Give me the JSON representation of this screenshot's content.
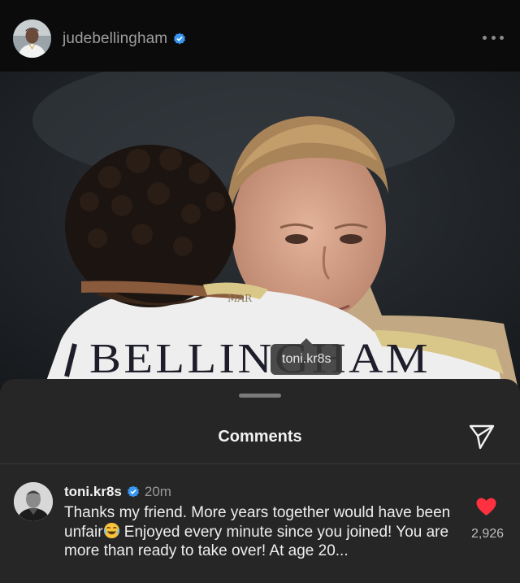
{
  "post": {
    "username": "judebellingham",
    "photo_tag": "toni.kr8s",
    "jersey_name": "BELLINGHAM",
    "jersey_sponsor": "MAR"
  },
  "comments_sheet": {
    "title": "Comments"
  },
  "comment": {
    "author": "toni.kr8s",
    "time": "20m",
    "text_part1": "Thanks my friend. More years together would have been unfair",
    "text_part2": " Enjoyed every minute since you joined! You are more than ready to take over! At age 20...",
    "likes": "2,926"
  },
  "colors": {
    "verified": "#3897f0",
    "like": "#ff3040"
  },
  "icons": [
    "verified-badge-icon",
    "more-options-icon",
    "share-icon",
    "heart-icon",
    "laughing-emoji-icon"
  ]
}
